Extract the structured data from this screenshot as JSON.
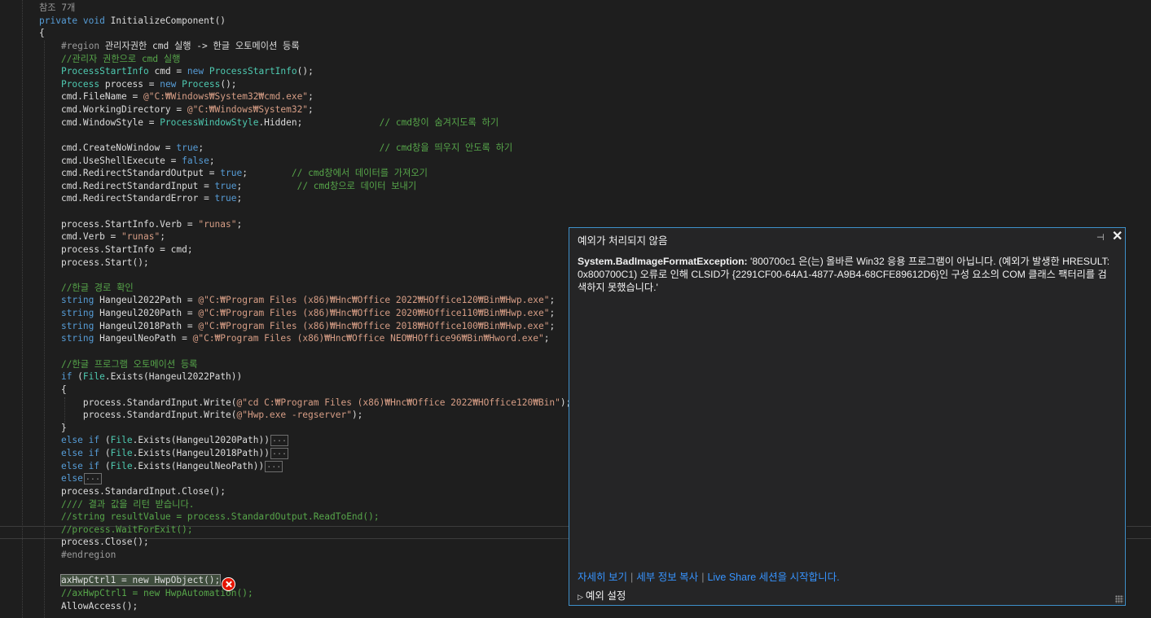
{
  "editor": {
    "lines": [
      {
        "tokens": [
          {
            "t": "참조 7개",
            "c": "ref"
          }
        ]
      },
      {
        "tokens": [
          {
            "t": "private",
            "c": "kw"
          },
          {
            "t": " "
          },
          {
            "t": "void",
            "c": "kw"
          },
          {
            "t": " InitializeComponent()"
          }
        ]
      },
      {
        "tokens": [
          {
            "t": "{"
          }
        ]
      },
      {
        "tokens": [
          {
            "t": "    "
          },
          {
            "t": "#region",
            "c": "pp"
          },
          {
            "t": " 관리자권한 cmd 실행 -> 한글 오토메이션 등록"
          }
        ]
      },
      {
        "tokens": [
          {
            "t": "    "
          },
          {
            "t": "//관리자 권한으로 cmd 실행",
            "c": "cm"
          }
        ]
      },
      {
        "tokens": [
          {
            "t": "    "
          },
          {
            "t": "ProcessStartInfo",
            "c": "ty"
          },
          {
            "t": " cmd = "
          },
          {
            "t": "new",
            "c": "kw"
          },
          {
            "t": " "
          },
          {
            "t": "ProcessStartInfo",
            "c": "ty"
          },
          {
            "t": "();"
          }
        ]
      },
      {
        "tokens": [
          {
            "t": "    "
          },
          {
            "t": "Process",
            "c": "ty"
          },
          {
            "t": " process = "
          },
          {
            "t": "new",
            "c": "kw"
          },
          {
            "t": " "
          },
          {
            "t": "Process",
            "c": "ty"
          },
          {
            "t": "();"
          }
        ]
      },
      {
        "tokens": [
          {
            "t": "    cmd.FileName = "
          },
          {
            "t": "@\"C:₩Windows₩System32₩cmd.exe\"",
            "c": "str"
          },
          {
            "t": ";"
          }
        ]
      },
      {
        "tokens": [
          {
            "t": "    cmd.WorkingDirectory = "
          },
          {
            "t": "@\"C:₩Windows₩System32\"",
            "c": "str"
          },
          {
            "t": ";"
          }
        ]
      },
      {
        "tokens": [
          {
            "t": "    cmd.WindowStyle = "
          },
          {
            "t": "ProcessWindowStyle",
            "c": "ty"
          },
          {
            "t": ".Hidden;              "
          },
          {
            "t": "// cmd창이 숨겨지도록 하기",
            "c": "cm"
          }
        ]
      },
      {
        "tokens": []
      },
      {
        "tokens": [
          {
            "t": "    cmd.CreateNoWindow = "
          },
          {
            "t": "true",
            "c": "kw"
          },
          {
            "t": ";                                "
          },
          {
            "t": "// cmd창을 띄우지 안도록 하기",
            "c": "cm"
          }
        ]
      },
      {
        "tokens": [
          {
            "t": "    cmd.UseShellExecute = "
          },
          {
            "t": "false",
            "c": "kw"
          },
          {
            "t": ";"
          }
        ]
      },
      {
        "tokens": [
          {
            "t": "    cmd.RedirectStandardOutput = "
          },
          {
            "t": "true",
            "c": "kw"
          },
          {
            "t": ";        "
          },
          {
            "t": "// cmd창에서 데이터를 가져오기",
            "c": "cm"
          }
        ]
      },
      {
        "tokens": [
          {
            "t": "    cmd.RedirectStandardInput = "
          },
          {
            "t": "true",
            "c": "kw"
          },
          {
            "t": ";          "
          },
          {
            "t": "// cmd창으로 데이터 보내기",
            "c": "cm"
          }
        ]
      },
      {
        "tokens": [
          {
            "t": "    cmd.RedirectStandardError = "
          },
          {
            "t": "true",
            "c": "kw"
          },
          {
            "t": ";"
          }
        ]
      },
      {
        "tokens": []
      },
      {
        "tokens": [
          {
            "t": "    process.StartInfo.Verb = "
          },
          {
            "t": "\"runas\"",
            "c": "str"
          },
          {
            "t": ";"
          }
        ]
      },
      {
        "tokens": [
          {
            "t": "    cmd.Verb = "
          },
          {
            "t": "\"runas\"",
            "c": "str"
          },
          {
            "t": ";"
          }
        ]
      },
      {
        "tokens": [
          {
            "t": "    process.StartInfo = cmd;"
          }
        ]
      },
      {
        "tokens": [
          {
            "t": "    process.Start();"
          }
        ]
      },
      {
        "tokens": []
      },
      {
        "tokens": [
          {
            "t": "    "
          },
          {
            "t": "//한글 경로 확인",
            "c": "cm"
          }
        ]
      },
      {
        "tokens": [
          {
            "t": "    "
          },
          {
            "t": "string",
            "c": "kw"
          },
          {
            "t": " Hangeul2022Path = "
          },
          {
            "t": "@\"C:₩Program Files (x86)₩Hnc₩Office 2022₩HOffice120₩Bin₩Hwp.exe\"",
            "c": "str"
          },
          {
            "t": ";"
          }
        ]
      },
      {
        "tokens": [
          {
            "t": "    "
          },
          {
            "t": "string",
            "c": "kw"
          },
          {
            "t": " Hangeul2020Path = "
          },
          {
            "t": "@\"C:₩Program Files (x86)₩Hnc₩Office 2020₩HOffice110₩Bin₩Hwp.exe\"",
            "c": "str"
          },
          {
            "t": ";"
          }
        ]
      },
      {
        "tokens": [
          {
            "t": "    "
          },
          {
            "t": "string",
            "c": "kw"
          },
          {
            "t": " Hangeul2018Path = "
          },
          {
            "t": "@\"C:₩Program Files (x86)₩Hnc₩Office 2018₩HOffice100₩Bin₩Hwp.exe\"",
            "c": "str"
          },
          {
            "t": ";"
          }
        ]
      },
      {
        "tokens": [
          {
            "t": "    "
          },
          {
            "t": "string",
            "c": "kw"
          },
          {
            "t": " HangeulNeoPath = "
          },
          {
            "t": "@\"C:₩Program Files (x86)₩Hnc₩Office NEO₩HOffice96₩Bin₩Hword.exe\"",
            "c": "str"
          },
          {
            "t": ";"
          }
        ]
      },
      {
        "tokens": []
      },
      {
        "tokens": [
          {
            "t": "    "
          },
          {
            "t": "//한글 프로그램 오토메이션 등록",
            "c": "cm"
          }
        ]
      },
      {
        "tokens": [
          {
            "t": "    "
          },
          {
            "t": "if",
            "c": "kw"
          },
          {
            "t": " ("
          },
          {
            "t": "File",
            "c": "ty"
          },
          {
            "t": ".Exists(Hangeul2022Path))"
          }
        ]
      },
      {
        "tokens": [
          {
            "t": "    {"
          }
        ]
      },
      {
        "tokens": [
          {
            "t": "        process.StandardInput.Write("
          },
          {
            "t": "@\"cd C:₩Program Files (x86)₩Hnc₩Office 2022₩HOffice120₩Bin\"",
            "c": "str"
          },
          {
            "t": ");"
          }
        ]
      },
      {
        "tokens": [
          {
            "t": "        process.StandardInput.Write("
          },
          {
            "t": "@\"Hwp.exe -regserver\"",
            "c": "str"
          },
          {
            "t": ");"
          }
        ]
      },
      {
        "tokens": [
          {
            "t": "    }"
          }
        ]
      },
      {
        "tokens": [
          {
            "t": "    "
          },
          {
            "t": "else",
            "c": "kw"
          },
          {
            "t": " "
          },
          {
            "t": "if",
            "c": "kw"
          },
          {
            "t": " ("
          },
          {
            "t": "File",
            "c": "ty"
          },
          {
            "t": ".Exists(Hangeul2020Path))"
          },
          {
            "t": "...",
            "c": "fold"
          }
        ]
      },
      {
        "tokens": [
          {
            "t": "    "
          },
          {
            "t": "else",
            "c": "kw"
          },
          {
            "t": " "
          },
          {
            "t": "if",
            "c": "kw"
          },
          {
            "t": " ("
          },
          {
            "t": "File",
            "c": "ty"
          },
          {
            "t": ".Exists(Hangeul2018Path))"
          },
          {
            "t": "...",
            "c": "fold"
          }
        ]
      },
      {
        "tokens": [
          {
            "t": "    "
          },
          {
            "t": "else",
            "c": "kw"
          },
          {
            "t": " "
          },
          {
            "t": "if",
            "c": "kw"
          },
          {
            "t": " ("
          },
          {
            "t": "File",
            "c": "ty"
          },
          {
            "t": ".Exists(HangeulNeoPath))"
          },
          {
            "t": "...",
            "c": "fold"
          }
        ]
      },
      {
        "tokens": [
          {
            "t": "    "
          },
          {
            "t": "else",
            "c": "kw"
          },
          {
            "t": "...",
            "c": "fold"
          }
        ]
      },
      {
        "tokens": [
          {
            "t": "    process.StandardInput.Close();"
          }
        ]
      },
      {
        "tokens": [
          {
            "t": "    "
          },
          {
            "t": "//// 결과 값을 리턴 받습니다.",
            "c": "cm"
          }
        ]
      },
      {
        "tokens": [
          {
            "t": "    "
          },
          {
            "t": "//string resultValue = process.StandardOutput.ReadToEnd();",
            "c": "cm"
          }
        ]
      },
      {
        "tokens": [
          {
            "t": "    "
          },
          {
            "t": "//process.WaitForExit();",
            "c": "cm"
          }
        ]
      },
      {
        "tokens": [
          {
            "t": "    process.Close();"
          }
        ]
      },
      {
        "tokens": [
          {
            "t": "    "
          },
          {
            "t": "#endregion",
            "c": "pp"
          }
        ]
      },
      {
        "tokens": []
      },
      {
        "tokens": [
          {
            "t": "    "
          },
          {
            "t": "axHwpCtrl1 = new HwpObject();",
            "c": "hl"
          }
        ]
      },
      {
        "tokens": [
          {
            "t": "    "
          },
          {
            "t": "//axHwpCtrl1 = new HwpAutomation();",
            "c": "cm"
          }
        ]
      },
      {
        "tokens": [
          {
            "t": "    AllowAccess();"
          }
        ]
      }
    ]
  },
  "exception_helper": {
    "title": "예외가 처리되지 않음",
    "pin_icon": "pin-icon",
    "close_icon": "close-icon",
    "exception_type": "System.BadImageFormatException:",
    "message": " '800700c1 은(는) 올바른 Win32 응용 프로그램이 아닙니다. (예외가 발생한 HRESULT: 0x800700C1) 오류로 인해 CLSID가 {2291CF00-64A1-4877-A9B4-68CFE89612D6}인 구성 요소의 COM 클래스 팩터리를 검색하지 못했습니다.'",
    "links": {
      "view_details": "자세히 보기",
      "copy_details": "세부 정보 복사",
      "live_share": "Live Share 세션을 시작합니다."
    },
    "settings_label": "예외 설정"
  },
  "colors": {
    "background": "#1e1e1e",
    "keyword": "#569cd6",
    "type": "#4ec9b0",
    "string": "#d69d85",
    "comment": "#57a64a",
    "link": "#3794ff",
    "popup_border": "#3e90c9"
  }
}
